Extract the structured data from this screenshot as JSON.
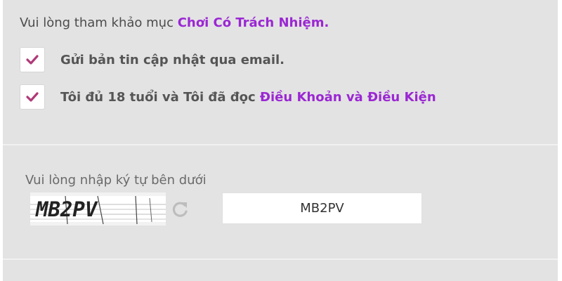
{
  "notice": {
    "prefix": "Vui lòng tham khảo mục ",
    "link_text": "Chơi Có Trách Nhiệm."
  },
  "checkboxes": [
    {
      "checked": true,
      "label": "Gửi bản tin cập nhật qua email.",
      "link_text": ""
    },
    {
      "checked": true,
      "label": "Tôi đủ 18 tuổi và Tôi đã đọc ",
      "link_text": "Điều Khoản và Điều Kiện"
    }
  ],
  "captcha": {
    "label": "Vui lòng nhập ký tự bên dưới",
    "image_text": "MB2PV",
    "refresh_icon": "refresh-icon",
    "input_value": "MB2PV"
  },
  "colors": {
    "panel_bg": "#e3e3e3",
    "link": "#9b27d3",
    "check_mark": "#b03a78",
    "text": "#555555"
  }
}
